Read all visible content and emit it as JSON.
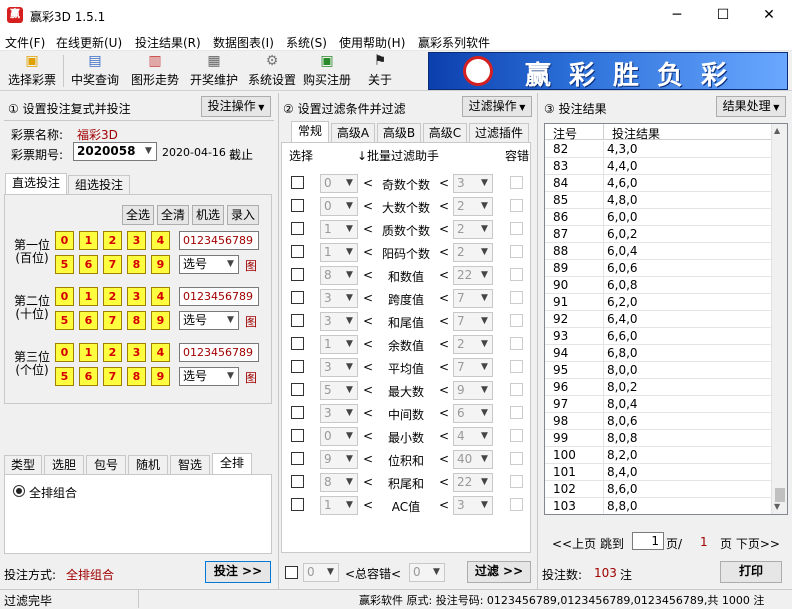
{
  "window": {
    "title": "赢彩3D 1.5.1",
    "icon_text": "赢"
  },
  "menu": [
    "文件(F)",
    "在线更新(U)",
    "投注结果(R)",
    "数据图表(I)",
    "系统(S)",
    "使用帮助(H)",
    "赢彩系列软件"
  ],
  "toolbar": [
    "选择彩票",
    "中奖查询",
    "图形走势",
    "开奖维护",
    "系统设置",
    "购买注册",
    "关于"
  ],
  "banner": {
    "text": "赢彩胜负彩"
  },
  "left": {
    "header": "① 设置投注复式并投注",
    "op_button": "投注操作",
    "lottery_label": "彩票名称:",
    "lottery_name": "福彩3D",
    "period_label": "彩票期号:",
    "period_value": "2020058",
    "date": "2020-04-16",
    "deadline": "截止",
    "tabs": [
      "直选投注",
      "组选投注"
    ],
    "quick_buttons": [
      "全选",
      "全清",
      "机选",
      "录入"
    ],
    "positions": [
      {
        "label1": "第一位",
        "label2": "(百位)",
        "digits": "0123456789"
      },
      {
        "label1": "第二位",
        "label2": "(十位)",
        "digits": "0123456789"
      },
      {
        "label1": "第三位",
        "label2": "(个位)",
        "digits": "0123456789"
      }
    ],
    "row1": [
      "0",
      "1",
      "2",
      "3",
      "4"
    ],
    "row2": [
      "5",
      "6",
      "7",
      "8",
      "9"
    ],
    "select_label": "选号",
    "chart_label": "图",
    "bottom_tabs": [
      "类型",
      "选胆",
      "包号",
      "随机",
      "智选",
      "全排"
    ],
    "radio_label": "全排组合",
    "method_label": "投注方式:",
    "method_value": "全排组合",
    "bet_button": "投注 >>"
  },
  "middle": {
    "header": "② 设置过滤条件并过滤",
    "op_button": "过滤操作",
    "tabs": [
      "常规",
      "高级A",
      "高级B",
      "高级C",
      "过滤插件"
    ],
    "col_select": "选择",
    "col_helper": "↓批量过滤助手",
    "col_tol": "容错",
    "filters": [
      {
        "min": "0",
        "name": "奇数个数",
        "max": "3"
      },
      {
        "min": "0",
        "name": "大数个数",
        "max": "2"
      },
      {
        "min": "1",
        "name": "质数个数",
        "max": "2"
      },
      {
        "min": "1",
        "name": "阳码个数",
        "max": "2"
      },
      {
        "min": "8",
        "name": "和数值",
        "max": "22"
      },
      {
        "min": "3",
        "name": "跨度值",
        "max": "7"
      },
      {
        "min": "3",
        "name": "和尾值",
        "max": "7"
      },
      {
        "min": "1",
        "name": "余数值",
        "max": "2"
      },
      {
        "min": "3",
        "name": "平均值",
        "max": "7"
      },
      {
        "min": "5",
        "name": "最大数",
        "max": "9"
      },
      {
        "min": "3",
        "name": "中间数",
        "max": "6"
      },
      {
        "min": "0",
        "name": "最小数",
        "max": "4"
      },
      {
        "min": "9",
        "name": "位积和",
        "max": "40"
      },
      {
        "min": "8",
        "name": "积尾和",
        "max": "22"
      },
      {
        "min": "1",
        "name": "AC值",
        "max": "3"
      }
    ],
    "lt": "<",
    "footer_min": "0",
    "footer_label": "<总容错<",
    "footer_max": "0",
    "filter_button": "过滤 >>"
  },
  "right": {
    "header": "③ 投注结果",
    "op_button": "结果处理",
    "col_no": "注号",
    "col_result": "投注结果",
    "rows": [
      [
        "82",
        "4,3,0"
      ],
      [
        "83",
        "4,4,0"
      ],
      [
        "84",
        "4,6,0"
      ],
      [
        "85",
        "4,8,0"
      ],
      [
        "86",
        "6,0,0"
      ],
      [
        "87",
        "6,0,2"
      ],
      [
        "88",
        "6,0,4"
      ],
      [
        "89",
        "6,0,6"
      ],
      [
        "90",
        "6,0,8"
      ],
      [
        "91",
        "6,2,0"
      ],
      [
        "92",
        "6,4,0"
      ],
      [
        "93",
        "6,6,0"
      ],
      [
        "94",
        "6,8,0"
      ],
      [
        "95",
        "8,0,0"
      ],
      [
        "96",
        "8,0,2"
      ],
      [
        "97",
        "8,0,4"
      ],
      [
        "98",
        "8,0,6"
      ],
      [
        "99",
        "8,0,8"
      ],
      [
        "100",
        "8,2,0"
      ],
      [
        "101",
        "8,4,0"
      ],
      [
        "102",
        "8,6,0"
      ],
      [
        "103",
        "8,8,0"
      ]
    ],
    "prev": "<<上页",
    "jump": "跳到",
    "page": "1",
    "page_sep": "页/",
    "total_pages": "1",
    "next": "页 下页>>",
    "count_label": "投注数:",
    "count": "103",
    "count_unit": "注",
    "print_button": "打印"
  },
  "status": {
    "left": "过滤完毕",
    "right": "赢彩软件 原式: 投注号码: 0123456789,0123456789,0123456789,共 1000 注"
  }
}
